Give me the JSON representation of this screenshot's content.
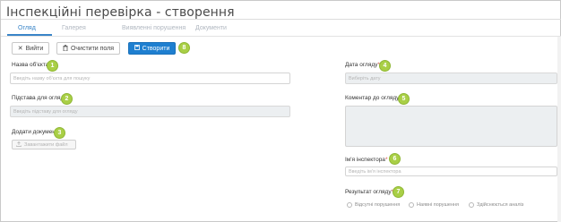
{
  "window": {
    "title": "Інспекційні перевірка - створення"
  },
  "tabs": [
    {
      "label": "Огляд",
      "active": true
    },
    {
      "label": "Галерея",
      "active": false
    },
    {
      "label": "Виявленні порушення",
      "active": false
    },
    {
      "label": "Документи",
      "active": false
    }
  ],
  "toolbar": {
    "exit_label": "Вийти",
    "clear_label": "Очистити поля",
    "create_label": "Створити",
    "create_badge": "8"
  },
  "form": {
    "object_name": {
      "label": "Назва об'єкта",
      "placeholder": "Введіть назву об'єкта для пошуку",
      "badge": "1"
    },
    "reason": {
      "label": "Підстава для огляду",
      "placeholder": "Введіть підставу для огляду",
      "badge": "2"
    },
    "add_document": {
      "label": "Додати документ",
      "button": "Завантажити файл",
      "badge": "3"
    },
    "date": {
      "label": "Дата огляду",
      "required_mark": "*",
      "placeholder": "Виберіть дату",
      "badge": "4"
    },
    "comment": {
      "label": "Коментар до огляду",
      "required_mark": "*",
      "badge": "5"
    },
    "inspector": {
      "label": "Ім'я інспектора",
      "required_mark": "*",
      "placeholder": "Введіть ім'я інспектора",
      "badge": "6"
    },
    "result": {
      "label": "Результат огляду",
      "required_mark": "*",
      "badge": "7",
      "options": [
        "Відсутні порушення",
        "Наявні порушення",
        "Здійснюється аналіз"
      ]
    }
  },
  "colors": {
    "accent": "#1e7fd0",
    "badge": "#a9cf46",
    "required": "#d9534f"
  }
}
